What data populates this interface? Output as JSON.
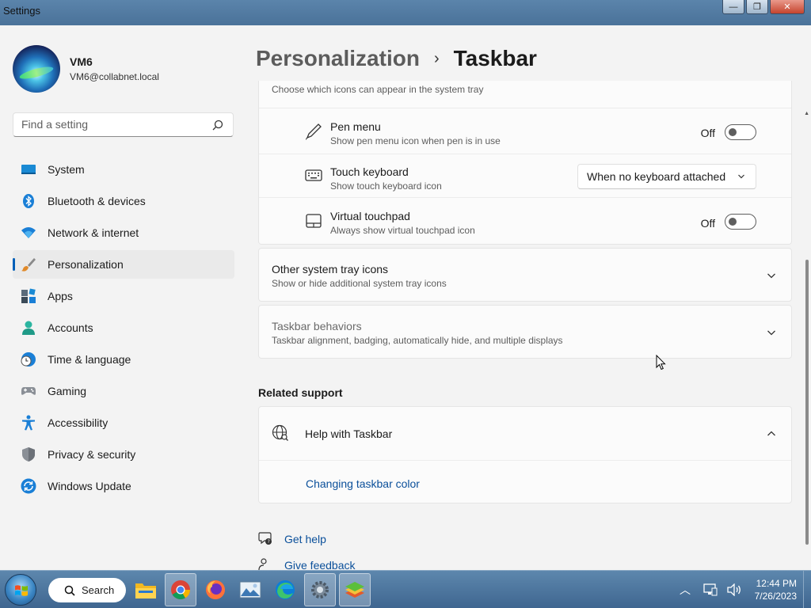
{
  "window": {
    "title": "Settings",
    "minimize": "—",
    "maximize": "❐",
    "close": "✕"
  },
  "profile": {
    "name": "VM6",
    "email": "VM6@collabnet.local"
  },
  "search": {
    "placeholder": "Find a setting"
  },
  "nav": [
    {
      "label": "System",
      "icon": "system-icon"
    },
    {
      "label": "Bluetooth & devices",
      "icon": "bluetooth-icon"
    },
    {
      "label": "Network & internet",
      "icon": "wifi-icon"
    },
    {
      "label": "Personalization",
      "icon": "brush-icon",
      "active": true
    },
    {
      "label": "Apps",
      "icon": "apps-icon"
    },
    {
      "label": "Accounts",
      "icon": "accounts-icon"
    },
    {
      "label": "Time & language",
      "icon": "clock-globe-icon"
    },
    {
      "label": "Gaming",
      "icon": "gamepad-icon"
    },
    {
      "label": "Accessibility",
      "icon": "accessibility-icon"
    },
    {
      "label": "Privacy & security",
      "icon": "shield-icon"
    },
    {
      "label": "Windows Update",
      "icon": "update-icon"
    }
  ],
  "breadcrumb": {
    "parent": "Personalization",
    "separator": "›",
    "current": "Taskbar"
  },
  "tray_card": {
    "header_sub": "Choose which icons can appear in the system tray",
    "rows": [
      {
        "title": "Pen menu",
        "sub": "Show pen menu icon when pen is in use",
        "control": "toggle",
        "state": "Off",
        "icon": "pen-icon"
      },
      {
        "title": "Touch keyboard",
        "sub": "Show touch keyboard icon",
        "control": "dropdown",
        "value": "When no keyboard attached",
        "icon": "keyboard-icon"
      },
      {
        "title": "Virtual touchpad",
        "sub": "Always show virtual touchpad icon",
        "control": "toggle",
        "state": "Off",
        "icon": "touchpad-icon"
      }
    ]
  },
  "other_tray": {
    "title": "Other system tray icons",
    "sub": "Show or hide additional system tray icons"
  },
  "behaviors": {
    "title": "Taskbar behaviors",
    "sub": "Taskbar alignment, badging, automatically hide, and multiple displays"
  },
  "related": {
    "title": "Related support",
    "help_title": "Help with Taskbar",
    "link": "Changing taskbar color"
  },
  "footer": {
    "get_help": "Get help",
    "give_feedback": "Give feedback"
  },
  "taskbar": {
    "search_label": "Search",
    "apps": [
      "file-explorer-icon",
      "chrome-icon",
      "firefox-icon",
      "photos-icon",
      "edge-icon",
      "settings-icon",
      "layers-app-icon"
    ],
    "time": "12:44 PM",
    "date": "7/26/2023"
  },
  "colors": {
    "accent": "#005fb8",
    "link": "#0a4f9a",
    "taskbar": "#4a7299"
  }
}
